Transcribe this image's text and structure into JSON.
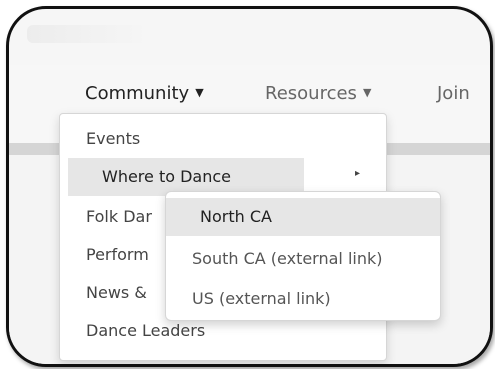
{
  "navbar": {
    "items": [
      {
        "label": "Community",
        "caret": "▼"
      },
      {
        "label": "Resources",
        "caret": "▼"
      },
      {
        "label": "Join",
        "caret": ""
      }
    ]
  },
  "dropdown": {
    "items": [
      {
        "label": "Events"
      },
      {
        "label": "Where to Dance",
        "submenu_arrow": "▸"
      },
      {
        "label": "Folk Dar"
      },
      {
        "label": "Perform"
      },
      {
        "label": "News &"
      },
      {
        "label": "Dance Leaders"
      }
    ]
  },
  "submenu": {
    "items": [
      {
        "label": "North CA"
      },
      {
        "label": "South CA (external link)"
      },
      {
        "label": "US  (external link)"
      }
    ]
  }
}
